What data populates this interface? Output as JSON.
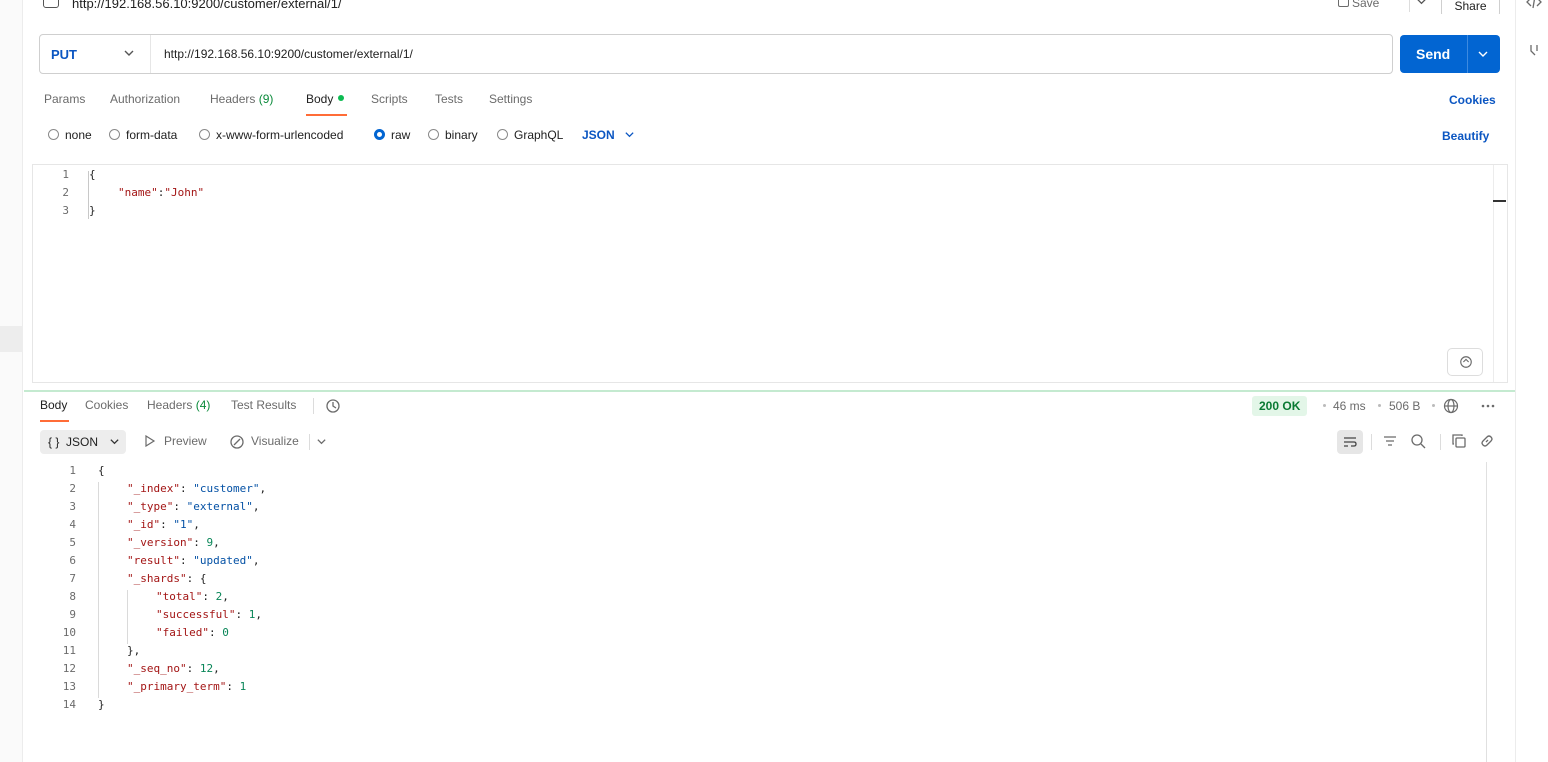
{
  "title": "http://192.168.56.10:9200/customer/external/1/",
  "header": {
    "save_label": "Save",
    "share_label": "Share"
  },
  "request": {
    "method": "PUT",
    "url": "http://192.168.56.10:9200/customer/external/1/",
    "send_label": "Send"
  },
  "request_tabs": [
    {
      "label": "Params"
    },
    {
      "label": "Authorization"
    },
    {
      "label": "Headers",
      "count": "(9)"
    },
    {
      "label": "Body",
      "active": true
    },
    {
      "label": "Scripts"
    },
    {
      "label": "Tests"
    },
    {
      "label": "Settings"
    }
  ],
  "cookies_link": "Cookies",
  "body_options": [
    "none",
    "form-data",
    "x-www-form-urlencoded",
    "raw",
    "binary",
    "GraphQL"
  ],
  "body_selected": "raw",
  "body_format": "JSON",
  "beautify_label": "Beautify",
  "request_body_lines": [
    {
      "n": "1",
      "text": "{"
    },
    {
      "n": "2",
      "key": "\"name\"",
      "sep": ":",
      "val": "\"John\""
    },
    {
      "n": "3",
      "text": "}"
    }
  ],
  "response_tabs": [
    {
      "label": "Body",
      "active": true
    },
    {
      "label": "Cookies"
    },
    {
      "label": "Headers",
      "count": "(4)"
    },
    {
      "label": "Test Results"
    }
  ],
  "response_meta": {
    "status": "200 OK",
    "time": "46 ms",
    "size": "506 B"
  },
  "response_toolbar": {
    "format": "JSON",
    "preview": "Preview",
    "visualize": "Visualize"
  },
  "response_body_lines": [
    {
      "n": "1",
      "indent": 0,
      "text": "{"
    },
    {
      "n": "2",
      "indent": 1,
      "key": "\"_index\"",
      "val": "\"customer\"",
      "type": "s",
      "tail": ","
    },
    {
      "n": "3",
      "indent": 1,
      "key": "\"_type\"",
      "val": "\"external\"",
      "type": "s",
      "tail": ","
    },
    {
      "n": "4",
      "indent": 1,
      "key": "\"_id\"",
      "val": "\"1\"",
      "type": "s",
      "tail": ","
    },
    {
      "n": "5",
      "indent": 1,
      "key": "\"_version\"",
      "val": "9",
      "type": "n",
      "tail": ","
    },
    {
      "n": "6",
      "indent": 1,
      "key": "\"result\"",
      "val": "\"updated\"",
      "type": "s",
      "tail": ","
    },
    {
      "n": "7",
      "indent": 1,
      "key": "\"_shards\"",
      "val": "{",
      "type": "p",
      "tail": ""
    },
    {
      "n": "8",
      "indent": 2,
      "key": "\"total\"",
      "val": "2",
      "type": "n",
      "tail": ","
    },
    {
      "n": "9",
      "indent": 2,
      "key": "\"successful\"",
      "val": "1",
      "type": "n",
      "tail": ","
    },
    {
      "n": "10",
      "indent": 2,
      "key": "\"failed\"",
      "val": "0",
      "type": "n",
      "tail": ""
    },
    {
      "n": "11",
      "indent": 1,
      "text": "},"
    },
    {
      "n": "12",
      "indent": 1,
      "key": "\"_seq_no\"",
      "val": "12",
      "type": "n",
      "tail": ","
    },
    {
      "n": "13",
      "indent": 1,
      "key": "\"_primary_term\"",
      "val": "1",
      "type": "n",
      "tail": ""
    },
    {
      "n": "14",
      "indent": 0,
      "text": "}"
    }
  ],
  "colors": {
    "accent": "#0265d2",
    "tab_underline": "#ff6c37",
    "status_ok": "#0a7a33"
  }
}
